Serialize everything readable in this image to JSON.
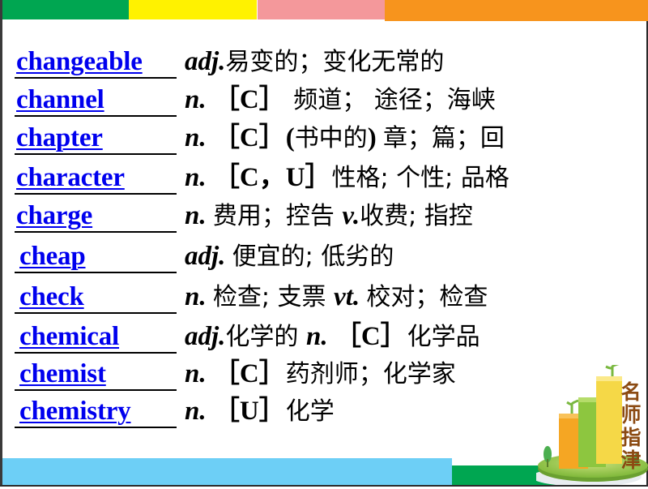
{
  "decoration": {
    "top_bars": [
      {
        "name": "green",
        "color": "#00a651"
      },
      {
        "name": "yellow",
        "color": "#fff200"
      },
      {
        "name": "pink",
        "color": "#f4989b"
      },
      {
        "name": "orange",
        "color": "#f7941d"
      }
    ],
    "bottom_bars": [
      {
        "name": "light-blue",
        "color": "#6dcff6"
      },
      {
        "name": "green",
        "color": "#00a651"
      }
    ]
  },
  "colors": {
    "word": "#0000ee",
    "definition": "#000000"
  },
  "entries": [
    {
      "word": "changeable",
      "parts": [
        {
          "t": "adj.",
          "k": "pos"
        },
        {
          "t": "易变的；变化无常的",
          "k": "zh"
        }
      ]
    },
    {
      "word": "channel",
      "parts": [
        {
          "t": "n. ",
          "k": "pos"
        },
        {
          "t": "［C］",
          "k": "bold"
        },
        {
          "t": " 频道； 途径；海峡",
          "k": "zh"
        }
      ]
    },
    {
      "word": "chapter",
      "parts": [
        {
          "t": "n. ",
          "k": "pos"
        },
        {
          "t": "［C］(",
          "k": "bold"
        },
        {
          "t": "书中的",
          "k": "zh"
        },
        {
          "t": ") ",
          "k": "bold"
        },
        {
          "t": "章；篇；回",
          "k": "zh"
        }
      ]
    },
    {
      "word": "character",
      "parts": [
        {
          "t": "n. ",
          "k": "pos"
        },
        {
          "t": "［C，U］",
          "k": "bold"
        },
        {
          "t": "性格; 个性; 品格",
          "k": "zh"
        }
      ]
    },
    {
      "word": "charge",
      "parts": [
        {
          "t": "n. ",
          "k": "pos"
        },
        {
          "t": "费用；控告 ",
          "k": "zh"
        },
        {
          "t": "v.",
          "k": "pos"
        },
        {
          "t": "收费; 指控",
          "k": "zh"
        }
      ]
    },
    {
      "word": "cheap",
      "indent": true,
      "parts": [
        {
          "t": "adj. ",
          "k": "pos"
        },
        {
          "t": "便宜的; 低劣的",
          "k": "zh"
        }
      ]
    },
    {
      "word": "check",
      "indent": true,
      "parts": [
        {
          "t": "n. ",
          "k": "pos"
        },
        {
          "t": "检查; 支票 ",
          "k": "zh"
        },
        {
          "t": "vt. ",
          "k": "pos"
        },
        {
          "t": "校对；检查",
          "k": "zh"
        }
      ]
    },
    {
      "word": "chemical",
      "indent": true,
      "parts": [
        {
          "t": "adj.",
          "k": "pos"
        },
        {
          "t": "化学的 ",
          "k": "zh"
        },
        {
          "t": "n. ",
          "k": "pos"
        },
        {
          "t": "［C］",
          "k": "bold"
        },
        {
          "t": "化学品",
          "k": "zh"
        }
      ]
    },
    {
      "word": "chemist",
      "indent": true,
      "parts": [
        {
          "t": "n. ",
          "k": "pos"
        },
        {
          "t": "［C］",
          "k": "bold"
        },
        {
          "t": "药剂师；化学家",
          "k": "zh"
        }
      ]
    },
    {
      "word": "chemistry",
      "indent": true,
      "parts": [
        {
          "t": "n. ",
          "k": "pos"
        },
        {
          "t": "［U］",
          "k": "bold"
        },
        {
          "t": "化学",
          "k": "zh"
        }
      ]
    }
  ],
  "logo": {
    "text": [
      "名",
      "师",
      "指",
      "津"
    ],
    "icon": "bar-chart-growth-icon"
  }
}
